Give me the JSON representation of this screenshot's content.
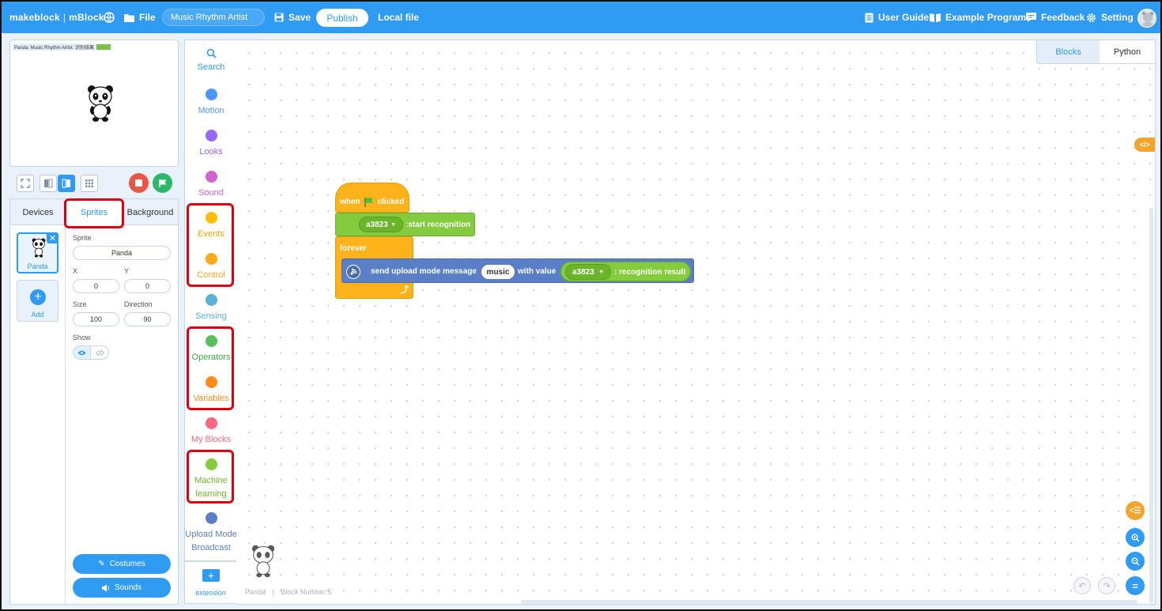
{
  "topbar": {
    "brand": "makeblock",
    "product": "mBlock",
    "file_label": "File",
    "project_name": "Music Rhythm Artist",
    "save_label": "Save",
    "publish_label": "Publish",
    "local_file_label": "Local file",
    "user_guide_label": "User Guide",
    "example_programs_label": "Example Programs",
    "feedback_label": "Feedback",
    "setting_label": "Setting"
  },
  "stage": {
    "monitor_label": "Panda: Music Rhythm Artist: 识别结果"
  },
  "sprite_panel": {
    "tabs": {
      "devices": "Devices",
      "sprites": "Sprites",
      "background": "Background"
    },
    "sprite_card_name": "Panda",
    "add_label": "Add",
    "labels": {
      "sprite": "Sprite",
      "x": "X",
      "y": "Y",
      "size": "Size",
      "direction": "Direction",
      "show": "Show"
    },
    "values": {
      "sprite": "Panda",
      "x": "0",
      "y": "0",
      "size": "100",
      "direction": "90"
    },
    "costumes_label": "Costumes",
    "sounds_label": "Sounds"
  },
  "categories": {
    "search": "Search",
    "motion": "Motion",
    "looks": "Looks",
    "sound": "Sound",
    "events": "Events",
    "control": "Control",
    "sensing": "Sensing",
    "operators": "Operators",
    "variables": "Variables",
    "my_blocks": "My Blocks",
    "ml_line1": "Machine",
    "ml_line2": "learning",
    "upload_line1": "Upload Mode",
    "upload_line2": "Broadcast",
    "extension": "extension"
  },
  "colors": {
    "topbar": "#2f9bf2",
    "motion": "#4c97ff",
    "looks": "#9966ff",
    "sound": "#cf63cf",
    "events": "#ffbf00",
    "control": "#ffab19",
    "sensing": "#5cb1d6",
    "operators": "#59c059",
    "variables": "#ff8c1a",
    "my_blocks": "#ff6680",
    "machine_learning": "#84cc3d",
    "upload_mode": "#5a7fc6",
    "highlight": "#e1000f"
  },
  "workspace": {
    "tabs": {
      "blocks": "Blocks",
      "python": "Python"
    },
    "code_toggle": "</>",
    "sprite_name": "Panda",
    "block_count": "Block Number:5",
    "script": {
      "when_label": "when",
      "clicked_label": "clicked",
      "model_name": "a3823",
      "start_recognition": ":start recognition",
      "forever_label": "forever",
      "send_message": "send upload mode message",
      "message_value": "music",
      "with_value": "with value",
      "recognition_result": ": recognition result"
    }
  }
}
